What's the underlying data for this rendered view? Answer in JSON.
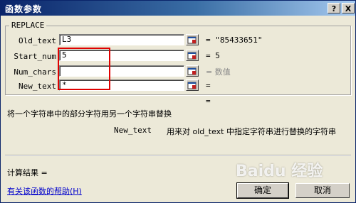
{
  "window": {
    "title": "函数参数",
    "help_glyph": "?",
    "close_glyph": "X"
  },
  "group": {
    "label": "REPLACE"
  },
  "args": [
    {
      "label": "Old_text",
      "value": "L3",
      "result": "= \"85433651\""
    },
    {
      "label": "Start_num",
      "value": "5",
      "result": "= 5"
    },
    {
      "label": "Num_chars",
      "value": "",
      "result": "= 数值"
    },
    {
      "label": "New_text",
      "value": "*",
      "result": "="
    }
  ],
  "formula_result_top": "=",
  "description": "将一个字符串中的部分字符用另一个字符串替换",
  "arg_help": {
    "name": "New_text",
    "text": "用来对 old_text 中指定字符串进行替换的字符串"
  },
  "calc_result_label": "计算结果 =",
  "help_link": "有关该函数的帮助(H)",
  "buttons": {
    "ok": "确定",
    "cancel": "取消"
  },
  "watermark": "Baidu 经验",
  "colors": {
    "titlebar": "#0a246a",
    "dialog_bg": "#ece9d8",
    "highlight_box": "#e00000",
    "link": "#0000cc"
  }
}
